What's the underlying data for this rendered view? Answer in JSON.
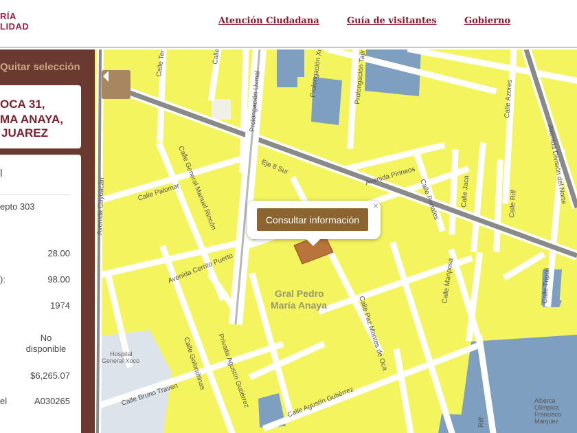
{
  "header": {
    "logo_lines": [
      "RÍA",
      "LIDAD"
    ],
    "nav": [
      "Atención Ciudadana",
      "Guía de visitantes",
      "Gobierno"
    ]
  },
  "sidebar": {
    "clear_selection": "Quitar selección",
    "address_lines": [
      "OCA 31,",
      "MA ANAYA,",
      "JUAREZ"
    ],
    "info_top": "l",
    "info_rows": [
      {
        "label": "",
        "value": "epto 303"
      },
      {
        "label": "",
        "value": "28.00"
      },
      {
        "label": "):",
        "value": "98.00"
      },
      {
        "label": "",
        "value": "1974"
      },
      {
        "label": "",
        "value": "No disponible"
      },
      {
        "label": "",
        "value": "$6,265.07"
      },
      {
        "label": "el",
        "value": "A030265"
      }
    ]
  },
  "map": {
    "popup_button": "Consultar información",
    "popup_close": "×",
    "colors": {
      "block": "#f4f45f",
      "street": "#ffffff",
      "park": "#7f9fc0",
      "highlight": "#b8743a",
      "major_road": "#8a8a8a"
    },
    "labels": {
      "neighborhood": [
        "Gral Pedro",
        "María Anaya"
      ],
      "hospital": [
        "Hospital",
        "General Xoco"
      ],
      "alberca": [
        "Alberca",
        "Olímpica",
        "Francisco",
        "Márquez"
      ],
      "eje": "Eje 8 Sur",
      "streets": [
        "Calle Tenayuca",
        "Calle",
        "Prolongación Uxmal",
        "Prolongación Xola",
        "Prolongación Tajín",
        "Calle Azores",
        "Avenida División del Norte",
        "Calle Palomar",
        "Calle General Manuel Rincón",
        "Avenida Pirineos",
        "Calle Portales",
        "Calle Jaca",
        "Calle Riff",
        "Avenida Cerrito Puerto",
        "Calle Paz Montes de Oca",
        "Calle Mariposa",
        "Calle Tripoli",
        "Calle Golondrinas",
        "Privada Agustín Gutiérrez",
        "Calle Bruno Traven",
        "Calle Agustín Gutiérrez",
        "Riff",
        "Avenida Coyoacán"
      ]
    }
  }
}
